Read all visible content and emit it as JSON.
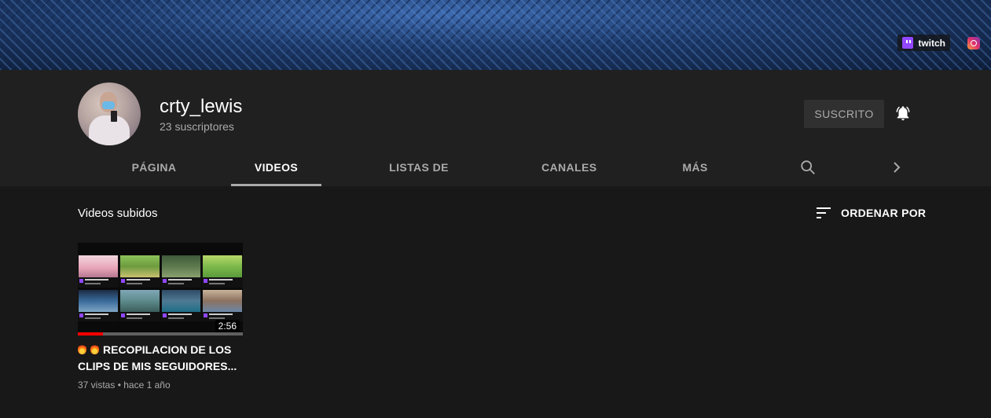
{
  "banner": {
    "links": [
      {
        "label": "twitch",
        "icon": "twitch-icon"
      },
      {
        "label": "",
        "icon": "instagram-icon"
      }
    ]
  },
  "channel": {
    "name": "crty_lewis",
    "subscribers": "23 suscriptores",
    "subscribe_label": "SUSCRITO"
  },
  "tabs": [
    {
      "label": "PÁGINA PRINCIPAL",
      "active": false
    },
    {
      "label": "VIDEOS",
      "active": true
    },
    {
      "label": "LISTAS DE REPRODUCCIÓN",
      "active": false
    },
    {
      "label": "CANALES",
      "active": false
    },
    {
      "label": "MÁS INFORMACIÓN",
      "active": false
    }
  ],
  "section": {
    "title": "Videos subidos",
    "sort_label": "ORDENAR POR"
  },
  "videos": [
    {
      "title": "RECOPILACION DE LOS CLIPS DE MIS SEGUIDORES...",
      "duration": "2:56",
      "views": "37 vistas",
      "age": "hace 1 año",
      "watched_fraction": 0.15
    }
  ],
  "colors": {
    "background": "#181818",
    "header_bg": "#202020",
    "accent_progress": "#ff0000",
    "twitch": "#9147ff"
  }
}
